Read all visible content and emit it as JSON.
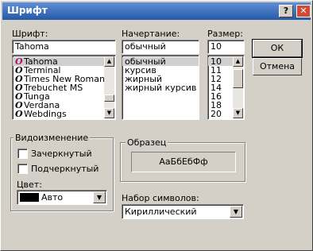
{
  "window": {
    "title": "Шрифт",
    "help_label": "?",
    "close_label": "✕"
  },
  "font": {
    "label": "Шрифт:",
    "value": "Tahoma",
    "items": [
      {
        "name": "Tahoma",
        "selected": true
      },
      {
        "name": "Terminal",
        "selected": false
      },
      {
        "name": "Times New Roman",
        "selected": false
      },
      {
        "name": "Trebuchet MS",
        "selected": false
      },
      {
        "name": "Tunga",
        "selected": false
      },
      {
        "name": "Verdana",
        "selected": false
      },
      {
        "name": "Webdings",
        "selected": false
      }
    ]
  },
  "style": {
    "label": "Начертание:",
    "value": "обычный",
    "items": [
      {
        "name": "обычный",
        "selected": true
      },
      {
        "name": "курсив",
        "selected": false
      },
      {
        "name": "жирный",
        "selected": false
      },
      {
        "name": "жирный курсив",
        "selected": false
      }
    ]
  },
  "size": {
    "label": "Размер:",
    "value": "10",
    "items": [
      {
        "name": "10",
        "selected": true
      },
      {
        "name": "11",
        "selected": false
      },
      {
        "name": "12",
        "selected": false
      },
      {
        "name": "14",
        "selected": false
      },
      {
        "name": "16",
        "selected": false
      },
      {
        "name": "18",
        "selected": false
      },
      {
        "name": "20",
        "selected": false
      }
    ]
  },
  "buttons": {
    "ok": "ОК",
    "cancel": "Отмена"
  },
  "effects": {
    "label": "Видоизменение",
    "strikeout": "Зачеркнутый",
    "underline": "Подчеркнутый",
    "color_label": "Цвет:",
    "color_value": "Авто",
    "color_swatch": "#000000"
  },
  "sample": {
    "label": "Образец",
    "text": "АаБбЕбФф"
  },
  "charset": {
    "label": "Набор символов:",
    "value": "Кириллический"
  },
  "icons": {
    "font_type": "O",
    "scroll_up": "▲",
    "scroll_down": "▼",
    "dropdown": "▼"
  },
  "colors": {
    "titlebar": "#2459a6",
    "font_icon": "#b0106a"
  }
}
